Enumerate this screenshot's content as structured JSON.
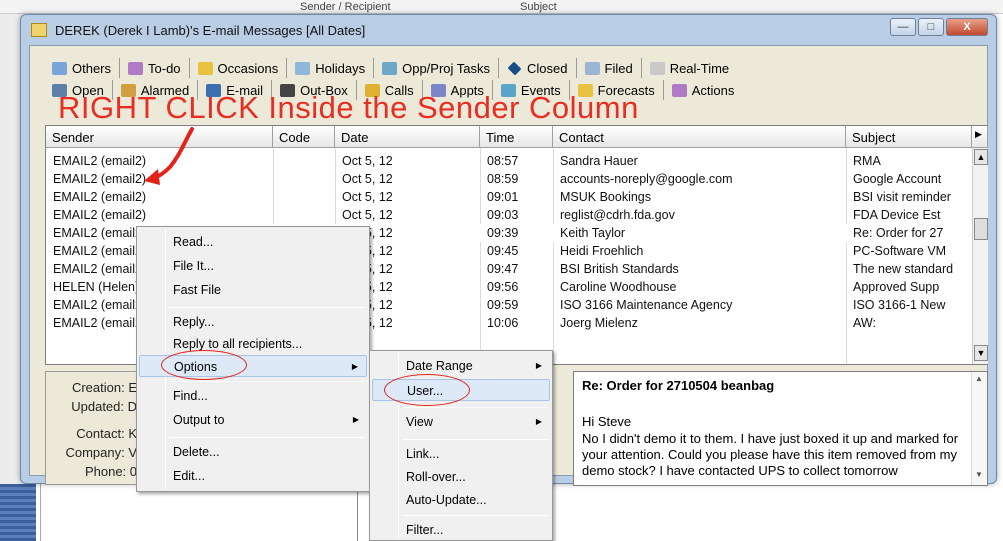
{
  "window": {
    "title": "DEREK (Derek I Lamb)'s E-mail Messages  [All Dates]",
    "min_label": "—",
    "max_label": "□",
    "close_label": "X"
  },
  "background": {
    "top_fragment_1": "Sender / Recipient",
    "top_fragment_2": "Subject"
  },
  "tabs_row1": [
    {
      "label": "Others",
      "icon": "people-icon"
    },
    {
      "label": "To-do",
      "icon": "checkmark-icon"
    },
    {
      "label": "Occasions",
      "icon": "star-icon"
    },
    {
      "label": "Holidays",
      "icon": "holiday-icon"
    },
    {
      "label": "Opp/Proj Tasks",
      "icon": "task-icon"
    },
    {
      "label": "Closed",
      "icon": "diamond-icon"
    },
    {
      "label": "Filed",
      "icon": "folder-icon"
    },
    {
      "label": "Real-Time",
      "icon": "clock-icon"
    }
  ],
  "tabs_row2": [
    {
      "label": "Open",
      "icon": "open-icon"
    },
    {
      "label": "Alarmed",
      "icon": "alarm-icon"
    },
    {
      "label": "E-mail",
      "icon": "email-icon"
    },
    {
      "label": "Out-Box",
      "icon": "outbox-icon"
    },
    {
      "label": "Calls",
      "icon": "phone-icon"
    },
    {
      "label": "Appts",
      "icon": "appointment-icon"
    },
    {
      "label": "Events",
      "icon": "events-icon"
    },
    {
      "label": "Forecasts",
      "icon": "forecast-icon"
    },
    {
      "label": "Actions",
      "icon": "actions-icon"
    }
  ],
  "columns": [
    "Sender",
    "Code",
    "Date",
    "Time",
    "Contact",
    "Subject"
  ],
  "rows": [
    {
      "sender": "EMAIL2 (email2)",
      "code": "",
      "date": "Oct 5, 12",
      "time": "08:57",
      "contact": "Sandra Hauer",
      "subject": "RMA"
    },
    {
      "sender": "EMAIL2 (email2)",
      "code": "",
      "date": "Oct 5, 12",
      "time": "08:59",
      "contact": "accounts-noreply@google.com",
      "subject": "Google Account"
    },
    {
      "sender": "EMAIL2 (email2)",
      "code": "",
      "date": "Oct 5, 12",
      "time": "09:01",
      "contact": "MSUK Bookings",
      "subject": "BSI visit reminder"
    },
    {
      "sender": "EMAIL2 (email2)",
      "code": "",
      "date": "Oct 5, 12",
      "time": "09:03",
      "contact": "reglist@cdrh.fda.gov",
      "subject": "FDA Device Est"
    },
    {
      "sender": "EMAIL2 (email2)",
      "code": "",
      "date": "Oct 5, 12",
      "time": "09:39",
      "contact": "Keith Taylor",
      "subject": "Re: Order for 27"
    },
    {
      "sender": "EMAIL2 (email2)",
      "code": "",
      "date": "Oct 5, 12",
      "time": "09:45",
      "contact": "Heidi Froehlich",
      "subject": "PC-Software VM"
    },
    {
      "sender": "EMAIL2 (email2)",
      "code": "",
      "date": "Oct 5, 12",
      "time": "09:47",
      "contact": "BSI British Standards",
      "subject": "The new standard"
    },
    {
      "sender": "HELEN (Helen)",
      "code": "",
      "date": "Oct 5, 12",
      "time": "09:56",
      "contact": "Caroline Woodhouse",
      "subject": "Approved Supp"
    },
    {
      "sender": "EMAIL2 (email2)",
      "code": "",
      "date": "Oct 5, 12",
      "time": "09:59",
      "contact": "ISO 3166 Maintenance Agency",
      "subject": "ISO 3166-1 New"
    },
    {
      "sender": "EMAIL2 (email2)",
      "code": "",
      "date": "Oct 5, 12",
      "time": "10:06",
      "contact": "Joerg Mielenz",
      "subject": "AW:"
    }
  ],
  "details": {
    "creation_label": "Creation: E",
    "updated_label": "Updated: D",
    "contact_label": "Contact: K",
    "company_label": "Company: V",
    "phone_label": "Phone: 0"
  },
  "preview": {
    "subject": "Re: Order for 2710504 beanbag",
    "greeting": "Hi Steve",
    "body": "No I didn't demo it to them. I have just boxed it up and marked for your attention. Could you please have this item removed from my demo stock? I have contacted UPS to collect tomorrow"
  },
  "context_menu": {
    "items": [
      "Read...",
      "File It...",
      "Fast File",
      "Reply...",
      "Reply to all recipients...",
      "Options",
      "Find...",
      "Output to",
      "Delete...",
      "Edit..."
    ]
  },
  "submenu": {
    "items": [
      "Date Range",
      "User...",
      "View",
      "Link...",
      "Roll-over...",
      "Auto-Update...",
      "Filter..."
    ]
  },
  "annotation": {
    "instruction": "RIGHT CLICK  Inside the Sender Column",
    "color": "#e2231a"
  }
}
